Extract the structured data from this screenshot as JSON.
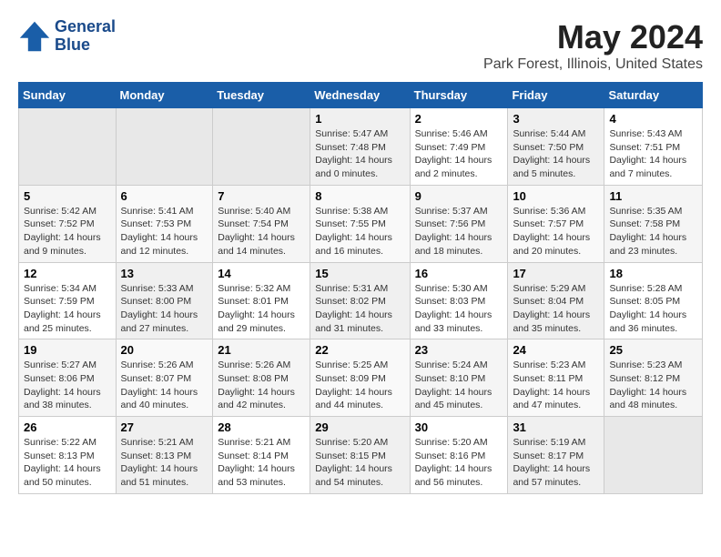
{
  "header": {
    "logo_line1": "General",
    "logo_line2": "Blue",
    "title": "May 2024",
    "subtitle": "Park Forest, Illinois, United States"
  },
  "days_of_week": [
    "Sunday",
    "Monday",
    "Tuesday",
    "Wednesday",
    "Thursday",
    "Friday",
    "Saturday"
  ],
  "weeks": [
    [
      {
        "day": "",
        "info": ""
      },
      {
        "day": "",
        "info": ""
      },
      {
        "day": "",
        "info": ""
      },
      {
        "day": "1",
        "info": "Sunrise: 5:47 AM\nSunset: 7:48 PM\nDaylight: 14 hours\nand 0 minutes."
      },
      {
        "day": "2",
        "info": "Sunrise: 5:46 AM\nSunset: 7:49 PM\nDaylight: 14 hours\nand 2 minutes."
      },
      {
        "day": "3",
        "info": "Sunrise: 5:44 AM\nSunset: 7:50 PM\nDaylight: 14 hours\nand 5 minutes."
      },
      {
        "day": "4",
        "info": "Sunrise: 5:43 AM\nSunset: 7:51 PM\nDaylight: 14 hours\nand 7 minutes."
      }
    ],
    [
      {
        "day": "5",
        "info": "Sunrise: 5:42 AM\nSunset: 7:52 PM\nDaylight: 14 hours\nand 9 minutes."
      },
      {
        "day": "6",
        "info": "Sunrise: 5:41 AM\nSunset: 7:53 PM\nDaylight: 14 hours\nand 12 minutes."
      },
      {
        "day": "7",
        "info": "Sunrise: 5:40 AM\nSunset: 7:54 PM\nDaylight: 14 hours\nand 14 minutes."
      },
      {
        "day": "8",
        "info": "Sunrise: 5:38 AM\nSunset: 7:55 PM\nDaylight: 14 hours\nand 16 minutes."
      },
      {
        "day": "9",
        "info": "Sunrise: 5:37 AM\nSunset: 7:56 PM\nDaylight: 14 hours\nand 18 minutes."
      },
      {
        "day": "10",
        "info": "Sunrise: 5:36 AM\nSunset: 7:57 PM\nDaylight: 14 hours\nand 20 minutes."
      },
      {
        "day": "11",
        "info": "Sunrise: 5:35 AM\nSunset: 7:58 PM\nDaylight: 14 hours\nand 23 minutes."
      }
    ],
    [
      {
        "day": "12",
        "info": "Sunrise: 5:34 AM\nSunset: 7:59 PM\nDaylight: 14 hours\nand 25 minutes."
      },
      {
        "day": "13",
        "info": "Sunrise: 5:33 AM\nSunset: 8:00 PM\nDaylight: 14 hours\nand 27 minutes."
      },
      {
        "day": "14",
        "info": "Sunrise: 5:32 AM\nSunset: 8:01 PM\nDaylight: 14 hours\nand 29 minutes."
      },
      {
        "day": "15",
        "info": "Sunrise: 5:31 AM\nSunset: 8:02 PM\nDaylight: 14 hours\nand 31 minutes."
      },
      {
        "day": "16",
        "info": "Sunrise: 5:30 AM\nSunset: 8:03 PM\nDaylight: 14 hours\nand 33 minutes."
      },
      {
        "day": "17",
        "info": "Sunrise: 5:29 AM\nSunset: 8:04 PM\nDaylight: 14 hours\nand 35 minutes."
      },
      {
        "day": "18",
        "info": "Sunrise: 5:28 AM\nSunset: 8:05 PM\nDaylight: 14 hours\nand 36 minutes."
      }
    ],
    [
      {
        "day": "19",
        "info": "Sunrise: 5:27 AM\nSunset: 8:06 PM\nDaylight: 14 hours\nand 38 minutes."
      },
      {
        "day": "20",
        "info": "Sunrise: 5:26 AM\nSunset: 8:07 PM\nDaylight: 14 hours\nand 40 minutes."
      },
      {
        "day": "21",
        "info": "Sunrise: 5:26 AM\nSunset: 8:08 PM\nDaylight: 14 hours\nand 42 minutes."
      },
      {
        "day": "22",
        "info": "Sunrise: 5:25 AM\nSunset: 8:09 PM\nDaylight: 14 hours\nand 44 minutes."
      },
      {
        "day": "23",
        "info": "Sunrise: 5:24 AM\nSunset: 8:10 PM\nDaylight: 14 hours\nand 45 minutes."
      },
      {
        "day": "24",
        "info": "Sunrise: 5:23 AM\nSunset: 8:11 PM\nDaylight: 14 hours\nand 47 minutes."
      },
      {
        "day": "25",
        "info": "Sunrise: 5:23 AM\nSunset: 8:12 PM\nDaylight: 14 hours\nand 48 minutes."
      }
    ],
    [
      {
        "day": "26",
        "info": "Sunrise: 5:22 AM\nSunset: 8:13 PM\nDaylight: 14 hours\nand 50 minutes."
      },
      {
        "day": "27",
        "info": "Sunrise: 5:21 AM\nSunset: 8:13 PM\nDaylight: 14 hours\nand 51 minutes."
      },
      {
        "day": "28",
        "info": "Sunrise: 5:21 AM\nSunset: 8:14 PM\nDaylight: 14 hours\nand 53 minutes."
      },
      {
        "day": "29",
        "info": "Sunrise: 5:20 AM\nSunset: 8:15 PM\nDaylight: 14 hours\nand 54 minutes."
      },
      {
        "day": "30",
        "info": "Sunrise: 5:20 AM\nSunset: 8:16 PM\nDaylight: 14 hours\nand 56 minutes."
      },
      {
        "day": "31",
        "info": "Sunrise: 5:19 AM\nSunset: 8:17 PM\nDaylight: 14 hours\nand 57 minutes."
      },
      {
        "day": "",
        "info": ""
      }
    ]
  ]
}
